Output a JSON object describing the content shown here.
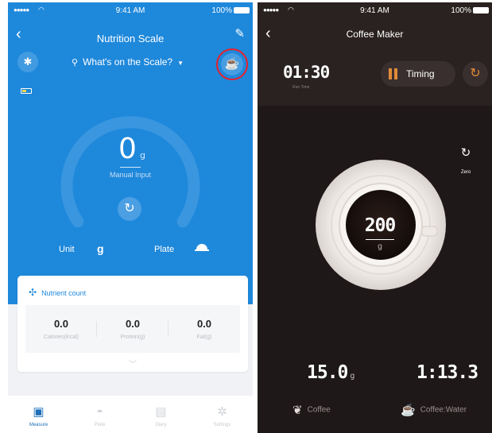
{
  "left": {
    "status": {
      "signal": "●●●●●",
      "time": "9:41 AM",
      "battery": "100%"
    },
    "nav": {
      "back": "‹",
      "title": "Nutrition Scale",
      "edit": "✎"
    },
    "scale_selector": {
      "label": "What's on the Scale?"
    },
    "reading": {
      "value": "0",
      "unit": "g",
      "manual_input": "Manual Input"
    },
    "unit": {
      "label": "Unit",
      "value": "g"
    },
    "plate": {
      "label": "Plate"
    },
    "nutrient": {
      "title": "Nutrient count",
      "items": [
        {
          "value": "0.0",
          "label": "Calories(Kcal)"
        },
        {
          "value": "0.0",
          "label": "Protein(g)"
        },
        {
          "value": "0.0",
          "label": "Fat(g)"
        }
      ]
    },
    "tabs": [
      {
        "label": "Measure",
        "icon": "scale-icon"
      },
      {
        "label": "Plate",
        "icon": "plate-icon"
      },
      {
        "label": "Diary",
        "icon": "diary-icon"
      },
      {
        "label": "Settings",
        "icon": "settings-icon"
      }
    ],
    "colors": {
      "primary": "#1e88db",
      "highlight_circle": "#e8202a"
    }
  },
  "right": {
    "status": {
      "signal": "●●●●●",
      "time": "9:41 AM",
      "battery": "100%"
    },
    "nav": {
      "back": "‹",
      "title": "Coffee Maker"
    },
    "run_time": {
      "value": "01:30",
      "label": "Run Time"
    },
    "timing_button": {
      "label": "Timing"
    },
    "zero": {
      "label": "Zero"
    },
    "cup": {
      "weight": "200",
      "unit": "g"
    },
    "coffee": {
      "value": "15.0",
      "unit": "g",
      "label": "Coffee"
    },
    "ratio": {
      "value": "1:13.3",
      "label": "Coffee:Water"
    },
    "colors": {
      "background": "#1f1818",
      "accent": "#e08b38"
    }
  }
}
